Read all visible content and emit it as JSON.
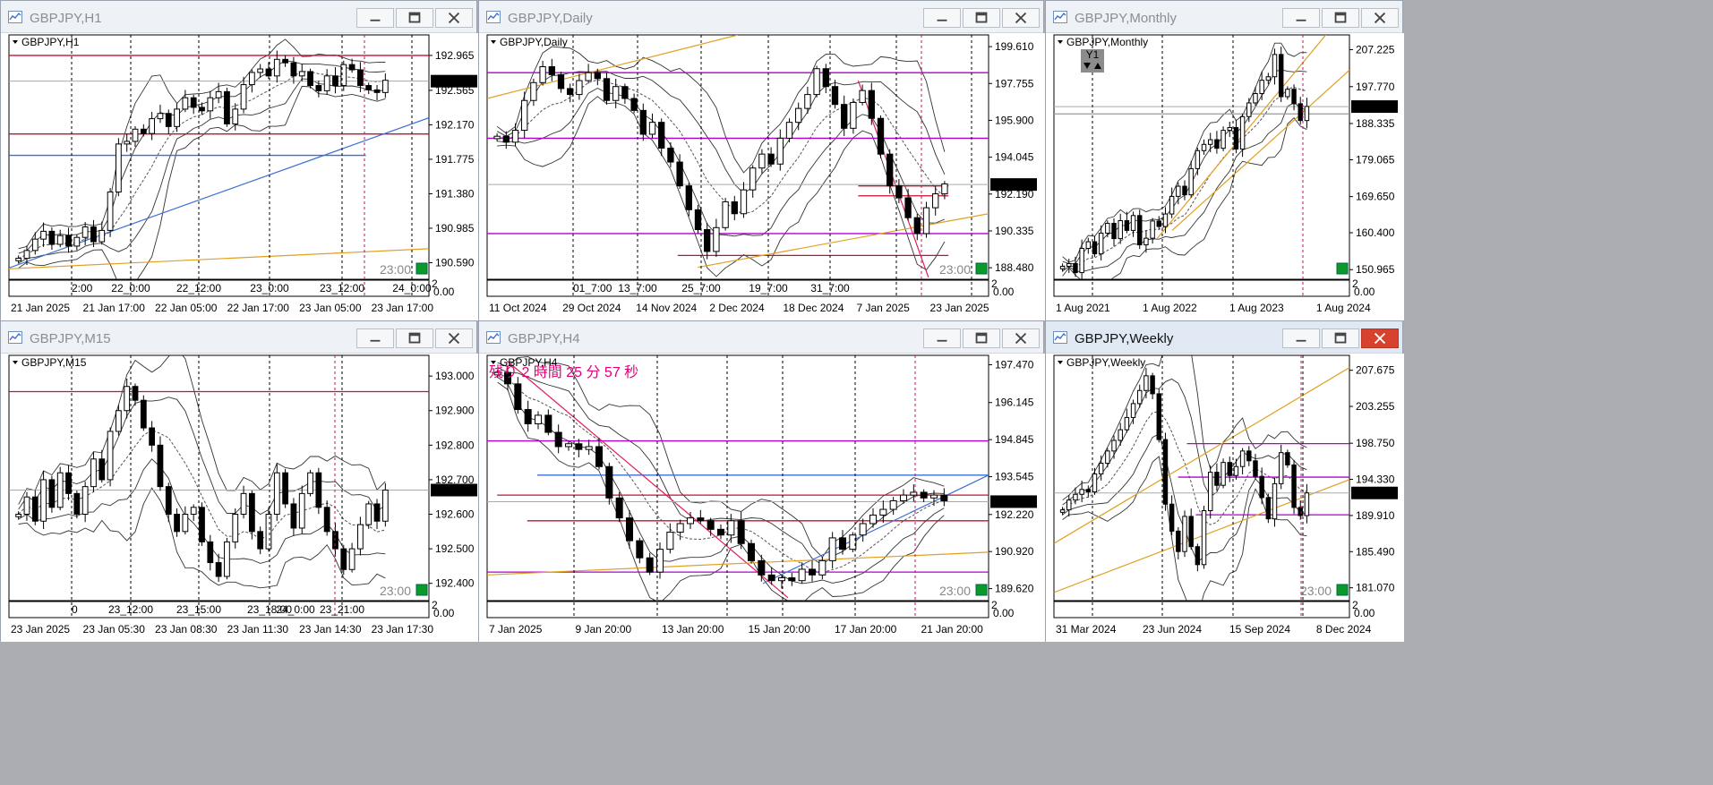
{
  "windows": [
    {
      "id": "h1",
      "title": "GBPJPY,H1",
      "symbol": "GBPJPY,H1",
      "active": false,
      "price_labels": [
        "192.965",
        "192.565",
        "192.170",
        "191.775",
        "191.380",
        "190.985",
        "190.590"
      ],
      "current_price": "192.670",
      "time_labels": [
        "21 Jan 2025",
        "21 Jan 17:00",
        "22 Jan 05:00",
        "22 Jan 17:00",
        "23 Jan 05:00",
        "23 Jan 17:00"
      ],
      "sub_time_labels": [
        "2:00",
        "22_0:00",
        "22_12:00",
        "23_0:00",
        "23_12:00",
        "24_0:00"
      ],
      "close_time": "23:00",
      "sub_digit": "2",
      "sub_zero": "0.00",
      "corner_badge": ""
    },
    {
      "id": "daily",
      "title": "GBPJPY,Daily",
      "symbol": "GBPJPY,Daily",
      "active": false,
      "price_labels": [
        "199.610",
        "197.755",
        "195.900",
        "194.045",
        "192.190",
        "190.335",
        "188.480"
      ],
      "current_price": "192.670",
      "time_labels": [
        "11 Oct 2024",
        "29 Oct 2024",
        "14 Nov 2024",
        "2 Dec 2024",
        "18 Dec 2024",
        "7 Jan 2025",
        "23 Jan 2025"
      ],
      "sub_time_labels": [
        "01_7:00",
        "13_7:00",
        "25_7:00",
        "19_7:00",
        "31_7:00"
      ],
      "close_time": "23:00",
      "sub_digit": "2",
      "sub_zero": "0.00",
      "corner_badge": ""
    },
    {
      "id": "monthly",
      "title": "GBPJPY,Monthly",
      "symbol": "GBPJPY,Monthly",
      "active": false,
      "price_labels": [
        "207.225",
        "197.770",
        "188.335",
        "179.065",
        "169.650",
        "160.400",
        "150.965"
      ],
      "current_price": "192.670",
      "time_labels": [
        "1 Aug 2021",
        "1 Aug 2022",
        "1 Aug 2023",
        "1 Aug 2024"
      ],
      "sub_time_labels": [],
      "close_time": "",
      "sub_digit": "2",
      "sub_zero": "0.00",
      "corner_badge": "Y1"
    },
    {
      "id": "m15",
      "title": "GBPJPY,M15",
      "symbol": "GBPJPY,M15",
      "active": false,
      "price_labels": [
        "193.000",
        "192.900",
        "192.800",
        "192.700",
        "192.600",
        "192.500",
        "192.400"
      ],
      "current_price": "192.670",
      "time_labels": [
        "23 Jan 2025",
        "23 Jan 05:30",
        "23 Jan 08:30",
        "23 Jan 11:30",
        "23 Jan 14:30",
        "23 Jan 17:30"
      ],
      "sub_time_labels": [
        "0",
        "23_12:00",
        "23_15:00",
        "23_18:00",
        "23_21:00",
        "24_0:00"
      ],
      "close_time": "23:00",
      "sub_digit": "2",
      "sub_zero": "0.00",
      "corner_badge": ""
    },
    {
      "id": "h4",
      "title": "GBPJPY,H4",
      "symbol": "GBPJPY,H4",
      "active": false,
      "price_labels": [
        "197.470",
        "196.145",
        "194.845",
        "193.545",
        "192.220",
        "190.920",
        "189.620"
      ],
      "current_price": "192.670",
      "time_labels": [
        "7 Jan 2025",
        "9 Jan 20:00",
        "13 Jan 20:00",
        "15 Jan 20:00",
        "17 Jan 20:00",
        "21 Jan 20:00"
      ],
      "sub_time_labels": [],
      "close_time": "23:00",
      "sub_digit": "2",
      "sub_zero": "0.00",
      "corner_badge": "",
      "countdown": "残り 2 時間 25 分 57 秒"
    },
    {
      "id": "weekly",
      "title": "GBPJPY,Weekly",
      "symbol": "GBPJPY,Weekly",
      "active": true,
      "price_labels": [
        "207.675",
        "203.255",
        "198.750",
        "194.330",
        "189.910",
        "185.490",
        "181.070"
      ],
      "current_price": "192.670",
      "time_labels": [
        "31 Mar 2024",
        "23 Jun 2024",
        "15 Sep 2024",
        "8 Dec 2024"
      ],
      "sub_time_labels": [],
      "close_time": "23:00",
      "sub_digit": "2",
      "sub_zero": "0.00",
      "corner_badge": ""
    }
  ],
  "chart_data": [
    {
      "type": "candlestick",
      "title": "GBPJPY,H1",
      "ylim": [
        190.4,
        193.2
      ],
      "y_ticks": [
        192.965,
        192.565,
        192.17,
        191.775,
        191.38,
        190.985,
        190.59
      ],
      "last_price": 192.67,
      "closes": [
        190.64,
        190.73,
        190.86,
        190.95,
        190.8,
        190.9,
        190.78,
        190.88,
        191.0,
        190.83,
        190.96,
        191.4,
        191.95,
        191.98,
        192.12,
        192.07,
        192.24,
        192.3,
        192.15,
        192.35,
        192.48,
        192.37,
        192.33,
        192.48,
        192.55,
        192.18,
        192.35,
        192.63,
        192.77,
        192.81,
        192.73,
        192.92,
        192.88,
        192.73,
        192.78,
        192.62,
        192.56,
        192.73,
        192.62,
        192.86,
        192.8,
        192.62,
        192.57,
        192.54,
        192.68
      ]
    },
    {
      "type": "candlestick",
      "title": "GBPJPY,Daily",
      "ylim": [
        187.9,
        200.2
      ],
      "y_ticks": [
        199.61,
        197.755,
        195.9,
        194.045,
        192.19,
        190.335,
        188.48
      ],
      "last_price": 192.67,
      "closes": [
        195.1,
        194.8,
        195.4,
        196.9,
        197.8,
        198.6,
        198.2,
        197.5,
        197.2,
        197.9,
        198.3,
        198.0,
        196.9,
        197.6,
        197.0,
        196.4,
        195.2,
        195.8,
        194.5,
        193.8,
        192.6,
        191.4,
        190.4,
        189.3,
        190.5,
        191.8,
        191.2,
        192.4,
        193.5,
        194.2,
        193.7,
        195.0,
        195.8,
        196.5,
        197.2,
        198.5,
        197.6,
        196.7,
        195.5,
        196.8,
        197.4,
        196.0,
        194.2,
        192.6,
        192.0,
        191.0,
        190.2,
        191.5,
        192.2,
        192.7
      ]
    },
    {
      "type": "candlestick",
      "title": "GBPJPY,Monthly",
      "ylim": [
        148.5,
        211.0
      ],
      "y_ticks": [
        207.225,
        197.77,
        188.335,
        179.065,
        169.65,
        160.4,
        150.965
      ],
      "last_price": 192.67,
      "closes": [
        151.8,
        152.5,
        150.2,
        156.4,
        158.1,
        155.0,
        160.3,
        162.8,
        158.9,
        163.5,
        161.0,
        164.8,
        157.3,
        159.0,
        163.4,
        162.0,
        165.2,
        169.7,
        172.3,
        170.1,
        176.8,
        181.4,
        183.0,
        184.2,
        182.0,
        186.6,
        187.3,
        181.8,
        190.1,
        193.6,
        196.0,
        199.4,
        200.3,
        206.0,
        195.2,
        197.1,
        193.4,
        189.1,
        192.7
      ]
    },
    {
      "type": "candlestick",
      "title": "GBPJPY,M15",
      "ylim": [
        192.35,
        193.06
      ],
      "y_ticks": [
        193.0,
        192.9,
        192.8,
        192.7,
        192.6,
        192.5,
        192.4
      ],
      "last_price": 192.67,
      "closes": [
        192.6,
        192.65,
        192.58,
        192.7,
        192.62,
        192.72,
        192.66,
        192.6,
        192.68,
        192.76,
        192.7,
        192.84,
        192.9,
        192.97,
        192.93,
        192.85,
        192.8,
        192.68,
        192.6,
        192.55,
        192.6,
        192.62,
        192.52,
        192.46,
        192.42,
        192.52,
        192.6,
        192.66,
        192.55,
        192.5,
        192.6,
        192.72,
        192.63,
        192.56,
        192.66,
        192.72,
        192.62,
        192.55,
        192.5,
        192.44,
        192.5,
        192.57,
        192.63,
        192.58,
        192.67
      ]
    },
    {
      "type": "candlestick",
      "title": "GBPJPY,H4",
      "ylim": [
        189.2,
        197.8
      ],
      "y_ticks": [
        197.47,
        196.145,
        194.845,
        193.545,
        192.22,
        190.92,
        189.62
      ],
      "last_price": 192.67,
      "closes": [
        197.2,
        196.8,
        195.9,
        195.4,
        195.7,
        195.1,
        194.6,
        194.7,
        194.5,
        194.6,
        193.9,
        192.8,
        192.1,
        191.3,
        190.7,
        190.2,
        191.0,
        191.6,
        191.9,
        192.1,
        192.0,
        191.7,
        191.5,
        192.0,
        191.2,
        190.6,
        190.1,
        189.9,
        190.0,
        189.9,
        190.3,
        190.1,
        190.6,
        191.4,
        191.0,
        191.5,
        191.9,
        192.2,
        192.4,
        192.7,
        192.9,
        193.0,
        192.8,
        192.9,
        192.7
      ]
    },
    {
      "type": "candlestick",
      "title": "GBPJPY,Weekly",
      "ylim": [
        179.5,
        209.5
      ],
      "y_ticks": [
        207.675,
        203.255,
        198.75,
        194.33,
        189.91,
        185.49,
        181.07
      ],
      "last_price": 192.67,
      "closes": [
        190.6,
        191.8,
        192.5,
        193.1,
        192.8,
        195.0,
        196.3,
        197.8,
        199.1,
        200.4,
        201.9,
        203.6,
        205.2,
        207.0,
        204.8,
        199.2,
        191.3,
        188.0,
        185.5,
        189.8,
        186.1,
        183.9,
        190.5,
        195.2,
        193.6,
        196.4,
        194.8,
        195.9,
        197.8,
        196.6,
        194.7,
        192.1,
        189.5,
        193.8,
        197.6,
        196.1,
        190.9,
        189.9,
        192.67
      ]
    }
  ]
}
